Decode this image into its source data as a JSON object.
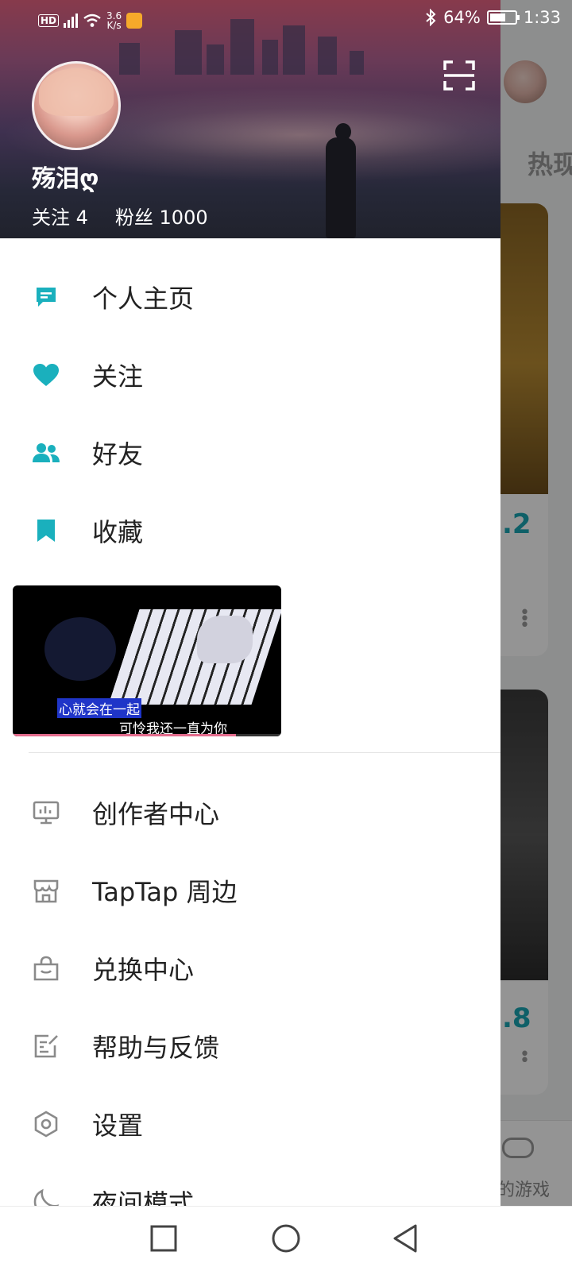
{
  "status_bar": {
    "left_icons": [
      "hd-icon",
      "4g-signal-icon",
      "wifi-icon",
      "net-speed",
      "app-notification-icon"
    ],
    "net_speed_value": "3.6",
    "net_speed_unit": "K/s",
    "battery_percent": "64%",
    "battery_level": 0.64,
    "time": "1:33"
  },
  "profile": {
    "username": "殇泪ღ",
    "following_label": "关注 4",
    "followers_label": "粉丝 1000"
  },
  "menu_top": [
    {
      "label": "个人主页",
      "icon": "profile-page-icon"
    },
    {
      "label": "关注",
      "icon": "heart-icon"
    },
    {
      "label": "好友",
      "icon": "friends-icon"
    },
    {
      "label": "收藏",
      "icon": "bookmark-icon"
    }
  ],
  "video_overlay": {
    "subtitle_line1": "心就会在一起",
    "subtitle_line2": "可怜我还一直为你",
    "progress": 0.83
  },
  "menu_bottom": [
    {
      "label": "创作者中心",
      "icon": "creator-center-icon"
    },
    {
      "label": "TapTap 周边",
      "icon": "store-icon"
    },
    {
      "label": "兑换中心",
      "icon": "shopping-bag-icon"
    },
    {
      "label": "帮助与反馈",
      "icon": "feedback-icon"
    },
    {
      "label": "设置",
      "icon": "settings-icon"
    },
    {
      "label": "夜间模式",
      "icon": "moon-icon"
    }
  ],
  "background_app": {
    "tab_partial": "热现",
    "score_1": ".2",
    "score_2": ".8",
    "bottom_nav_label": "的游戏"
  },
  "colors": {
    "accent": "#1ab0bd",
    "menu_text": "#222222",
    "secondary_icon": "#8a8a8a"
  },
  "nav_bar": [
    "recent-apps-button",
    "home-button",
    "back-button"
  ]
}
